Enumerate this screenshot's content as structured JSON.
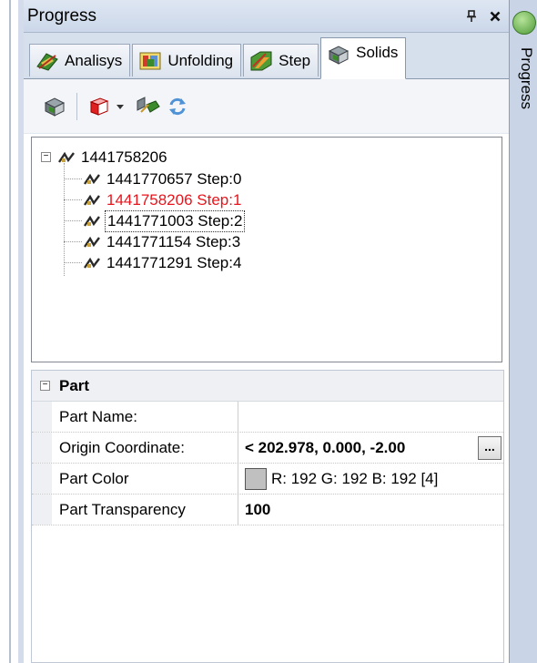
{
  "window": {
    "title": "Progress",
    "pin_glyph": "❙",
    "close_glyph": "✕"
  },
  "tabs": [
    {
      "label": "Analisys",
      "icon": "analysis-icon"
    },
    {
      "label": "Unfolding",
      "icon": "unfolding-icon"
    },
    {
      "label": "Step",
      "icon": "step-icon"
    },
    {
      "label": "Solids",
      "icon": "solids-icon",
      "active": true
    }
  ],
  "toolbar": {
    "tools": [
      "solid-view-icon",
      "color-cube-icon",
      "dropdown-arrow-icon",
      "move-solid-icon",
      "refresh-icon"
    ]
  },
  "tree": {
    "root": {
      "label": "1441758206",
      "expander": "−"
    },
    "children": [
      {
        "label": "1441770657 Step:0"
      },
      {
        "label": "1441758206 Step:1",
        "state": "highlighted-red"
      },
      {
        "label": "1441771003 Step:2",
        "state": "selected"
      },
      {
        "label": "1441771154 Step:3"
      },
      {
        "label": "1441771291 Step:4"
      }
    ]
  },
  "properties": {
    "category": {
      "label": "Part",
      "expander": "−"
    },
    "rows": [
      {
        "key": "Part Name:",
        "value": ""
      },
      {
        "key": "Origin Coordinate:",
        "value": "< 202.978, 0.000, -2.00",
        "button": "..."
      },
      {
        "key": "Part Color",
        "value": "R: 192 G: 192 B: 192 [4]",
        "swatch": "#c0c0c0"
      },
      {
        "key": "Part Transparency",
        "value": "100"
      }
    ]
  },
  "side_panel": {
    "label": "Progress",
    "icon": "progress-status-icon"
  },
  "colors": {
    "accent": "#3a64a8",
    "highlight_red": "#e8141b",
    "titlebar": "#cbd7e9"
  }
}
